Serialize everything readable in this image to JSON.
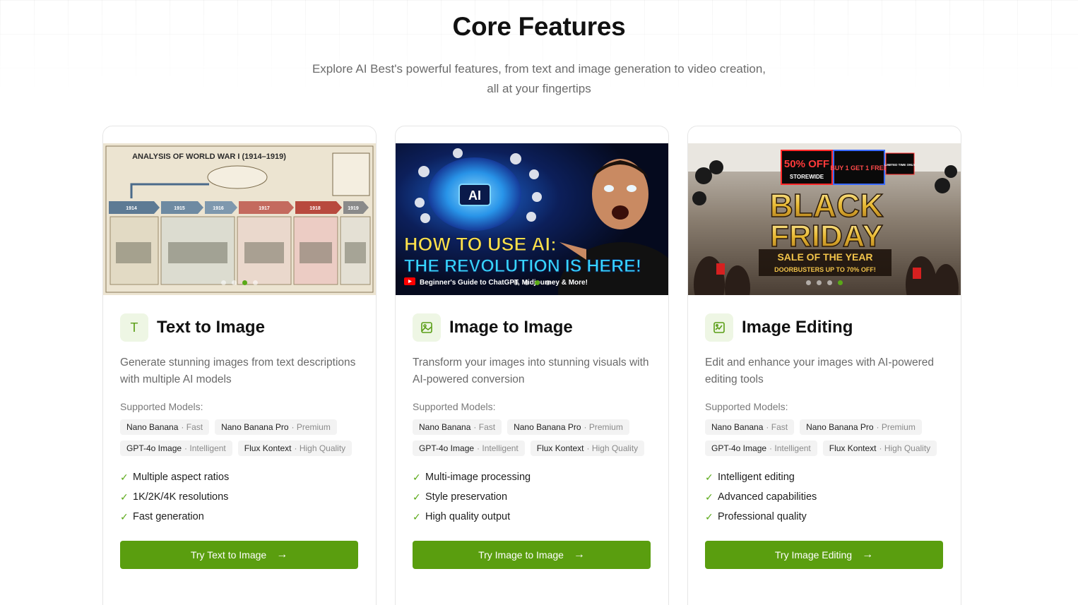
{
  "header": {
    "title": "Core Features",
    "subtitle": "Explore AI Best's powerful features, from text and image generation to video creation, all at your fingertips"
  },
  "cards": [
    {
      "title": "Text to Image",
      "icon": "text-t-icon",
      "description": "Generate stunning images from text descriptions with multiple AI models",
      "models_label": "Supported Models:",
      "models": [
        {
          "name": "Nano Banana",
          "tier": "Fast"
        },
        {
          "name": "Nano Banana Pro",
          "tier": "Premium"
        },
        {
          "name": "GPT-4o Image",
          "tier": "Intelligent"
        },
        {
          "name": "Flux Kontext",
          "tier": "High Quality"
        }
      ],
      "features": [
        "Multiple aspect ratios",
        "1K/2K/4K resolutions",
        "Fast generation"
      ],
      "cta": "Try Text to Image",
      "image": {
        "title": "ANALYSIS OF WORLD WAR I (1914–1919)",
        "years": [
          "1914",
          "1915",
          "1916",
          "1917",
          "1918",
          "1919"
        ]
      }
    },
    {
      "title": "Image to Image",
      "icon": "image-icon",
      "description": "Transform your images into stunning visuals with AI-powered conversion",
      "models_label": "Supported Models:",
      "models": [
        {
          "name": "Nano Banana",
          "tier": "Fast"
        },
        {
          "name": "Nano Banana Pro",
          "tier": "Premium"
        },
        {
          "name": "GPT-4o Image",
          "tier": "Intelligent"
        },
        {
          "name": "Flux Kontext",
          "tier": "High Quality"
        }
      ],
      "features": [
        "Multi-image processing",
        "Style preservation",
        "High quality output"
      ],
      "cta": "Try Image to Image",
      "image": {
        "badge": "AI",
        "headline1": "HOW TO USE AI:",
        "headline2": "THE REVOLUTION IS HERE!",
        "caption": "Beginner's Guide to ChatGPT, Midjourney & More!"
      }
    },
    {
      "title": "Image Editing",
      "icon": "image-edit-icon",
      "description": "Edit and enhance your images with AI-powered editing tools",
      "models_label": "Supported Models:",
      "models": [
        {
          "name": "Nano Banana",
          "tier": "Fast"
        },
        {
          "name": "Nano Banana Pro",
          "tier": "Premium"
        },
        {
          "name": "GPT-4o Image",
          "tier": "Intelligent"
        },
        {
          "name": "Flux Kontext",
          "tier": "High Quality"
        }
      ],
      "features": [
        "Intelligent editing",
        "Advanced capabilities",
        "Professional quality"
      ],
      "cta": "Try Image Editing",
      "image": {
        "line1": "BLACK",
        "line2": "FRIDAY",
        "line3": "SALE OF THE YEAR",
        "line4": "DOORBUSTERS UP TO 70% OFF!",
        "sign1": "50% OFF",
        "sign1b": "STOREWIDE",
        "sign2": "BUY 1 GET 1 FREE",
        "sign3": "LIMITED TIME ONLY"
      }
    }
  ],
  "colors": {
    "accent": "#5a9e0f",
    "accent_light": "#eef6e4"
  }
}
